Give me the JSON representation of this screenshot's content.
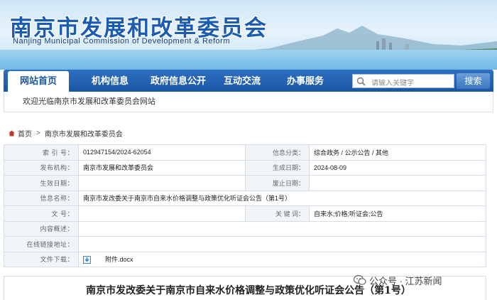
{
  "header": {
    "title_cn": "南京市发展和改革委员会",
    "title_en": "Nanjing Municipal Commission of Development & Reform"
  },
  "nav": {
    "items": [
      {
        "label": "网站首页",
        "active": true
      },
      {
        "label": "机构信息",
        "active": false
      },
      {
        "label": "政府信息公开",
        "active": false
      },
      {
        "label": "互动交流",
        "active": false
      },
      {
        "label": "办事服务",
        "active": false
      }
    ],
    "search_placeholder": "请输入关键字",
    "search_button": "搜索"
  },
  "welcome": "欢迎光临南京市发展和改革委员会网站",
  "breadcrumb": {
    "home": "首页",
    "sep": ">",
    "current": "南京市发展和改革委员会"
  },
  "info": {
    "index_label": "索 引 号：",
    "index_value": "012947154/2024-62054",
    "category_label": "信息分类：",
    "category_value": "综合政务 / 公示公告 / 其他",
    "publisher_label": "发布机构：",
    "publisher_value": "南京市发展和改革委员会",
    "date_label": "生成日期：",
    "date_value": "2024-08-09",
    "effective_label": "生效日期：",
    "effective_value": "",
    "expire_label": "废止日期：",
    "expire_value": "",
    "name_label": "信息名称：",
    "name_value": "南京市发改委关于南京市自来水价格调整与政策优化听证会公告（第1号）",
    "docno_label": "文 号：",
    "docno_value": "",
    "keyword_label": "关 键 词：",
    "keyword_value": "自来水;价格;听证会;公告",
    "summary_label": "内容概述：",
    "summary_value": "",
    "link_label": "在线链接地址：",
    "link_value": "",
    "download_label": "文件下载：",
    "download_value": "附件.docx"
  },
  "article_title": "南京市发改委关于南京市自来水价格调整与政策优化听证会公告（第1号）",
  "watermark": "公众号 · 江苏新闻",
  "colors": {
    "primary": "#1a56a6",
    "label_bg": "#f1f5fa",
    "border": "#d5dde8"
  }
}
